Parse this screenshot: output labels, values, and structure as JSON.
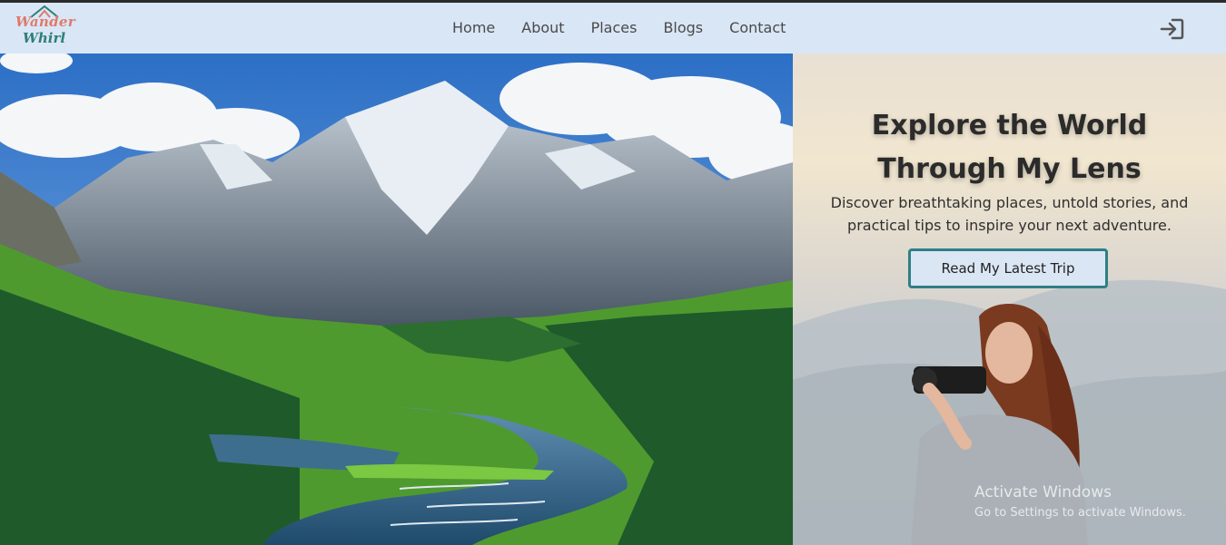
{
  "brand": {
    "line1": "Wander",
    "line2": "Whirl"
  },
  "nav": {
    "items": [
      {
        "label": "Home"
      },
      {
        "label": "About"
      },
      {
        "label": "Places"
      },
      {
        "label": "Blogs"
      },
      {
        "label": "Contact"
      }
    ],
    "login_icon": "sign-in-icon"
  },
  "hero": {
    "title_line1": "Explore the World",
    "title_line2": "Through My Lens",
    "subtitle_line1": "Discover breathtaking places, untold stories, and",
    "subtitle_line2": "practical tips to inspire your next adventure.",
    "cta_label": "Read My Latest Trip",
    "left_image": "mountain-lake-landscape-photo",
    "right_image": "woman-photographer-photo"
  },
  "os_watermark": {
    "line1": "Activate Windows",
    "line2": "Go to Settings to activate Windows."
  },
  "colors": {
    "navbar_bg": "#d9e6f6",
    "logo_coral": "#e07a6a",
    "logo_teal": "#2f7f77",
    "cta_border": "#2f7f84",
    "cta_bg": "#dbe6f5"
  }
}
